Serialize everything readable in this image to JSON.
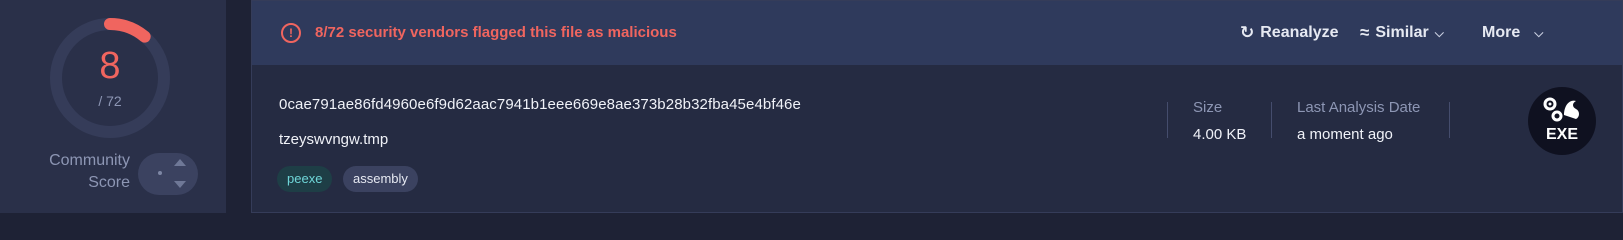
{
  "score": {
    "detections": "8",
    "total": "/ 72",
    "fraction": 0.111,
    "ring_color": "#f0655f",
    "track_color": "#353c59",
    "community_label_line1": "Community",
    "community_label_line2": "Score"
  },
  "alert": {
    "icon": "alert-circle-icon",
    "text": "8/72 security vendors flagged this file as malicious",
    "color": "#f0655f"
  },
  "actions": {
    "reanalyze": "Reanalyze",
    "similar": "Similar",
    "more": "More"
  },
  "file": {
    "hash": "0cae791ae86fd4960e6f9d62aac7941b1eee669e8ae373b28b32fba45e4bf46e",
    "name": "tzeyswvngw.tmp",
    "tags": [
      "peexe",
      "assembly"
    ]
  },
  "meta": {
    "size_label": "Size",
    "size_value": "4.00 KB",
    "date_label": "Last Analysis Date",
    "date_value": "a moment ago"
  },
  "file_type": {
    "label": "EXE",
    "icon": "exe-gears-icon"
  }
}
